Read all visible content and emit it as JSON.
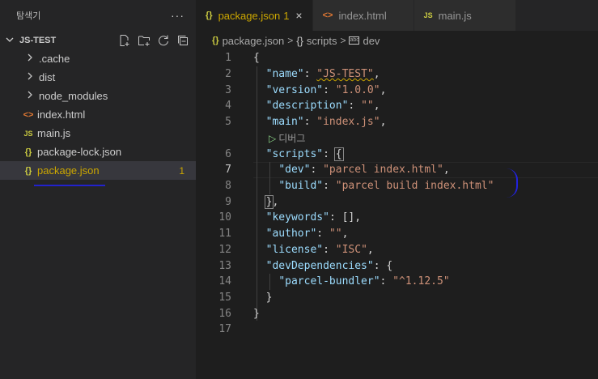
{
  "sidebar": {
    "title": "탐색기",
    "more": "···",
    "section": "JS-TEST",
    "items": [
      {
        "label": ".cache",
        "type": "folder",
        "icon": "chevron-right-icon"
      },
      {
        "label": "dist",
        "type": "folder",
        "icon": "chevron-right-icon"
      },
      {
        "label": "node_modules",
        "type": "folder",
        "icon": "chevron-right-icon"
      },
      {
        "label": "index.html",
        "type": "file",
        "icon": "html-file-icon",
        "glyph": "<>"
      },
      {
        "label": "main.js",
        "type": "file",
        "icon": "js-file-icon",
        "glyph": "JS"
      },
      {
        "label": "package-lock.json",
        "type": "file",
        "icon": "json-file-icon",
        "glyph": "{}"
      },
      {
        "label": "package.json",
        "type": "file",
        "icon": "json-file-icon",
        "glyph": "{}",
        "selected": true,
        "badge": "1"
      }
    ]
  },
  "tabs": [
    {
      "label": "package.json",
      "glyph": "{}",
      "dirty_count": "1",
      "active": true,
      "close": "×"
    },
    {
      "label": "index.html",
      "glyph": "<>",
      "active": false
    },
    {
      "label": "main.js",
      "glyph": "JS",
      "active": false
    }
  ],
  "breadcrumb": {
    "file": "package.json",
    "sep1": ">",
    "obj1": "scripts",
    "sep2": ">",
    "obj2": "dev",
    "obj_glyph": "{}",
    "prop_glyph": "abc"
  },
  "code_lens": {
    "label": "디버그",
    "icon": "play-icon"
  },
  "code": {
    "line_numbers": [
      "1",
      "2",
      "3",
      "4",
      "5",
      "6",
      "7",
      "8",
      "9",
      "10",
      "11",
      "12",
      "13",
      "14",
      "15",
      "16",
      "17"
    ],
    "name_key": "\"name\"",
    "name_val": "\"JS-TEST\"",
    "version_key": "\"version\"",
    "version_val": "\"1.0.0\"",
    "description_key": "\"description\"",
    "description_val": "\"\"",
    "main_key": "\"main\"",
    "main_val": "\"index.js\"",
    "scripts_key": "\"scripts\"",
    "dev_key": "\"dev\"",
    "dev_val": "\"parcel index.html\"",
    "build_key": "\"build\"",
    "build_val": "\"parcel build index.html\"",
    "keywords_key": "\"keywords\"",
    "author_key": "\"author\"",
    "author_val": "\"\"",
    "license_key": "\"license\"",
    "license_val": "\"ISC\"",
    "devdeps_key": "\"devDependencies\"",
    "parcel_key": "\"parcel-bundler\"",
    "parcel_val": "\"^1.12.5\""
  },
  "colors": {
    "warning": "#cca700",
    "json_key": "#9cdcfe",
    "json_string": "#ce9178",
    "annotation_blue": "#2222cc"
  }
}
